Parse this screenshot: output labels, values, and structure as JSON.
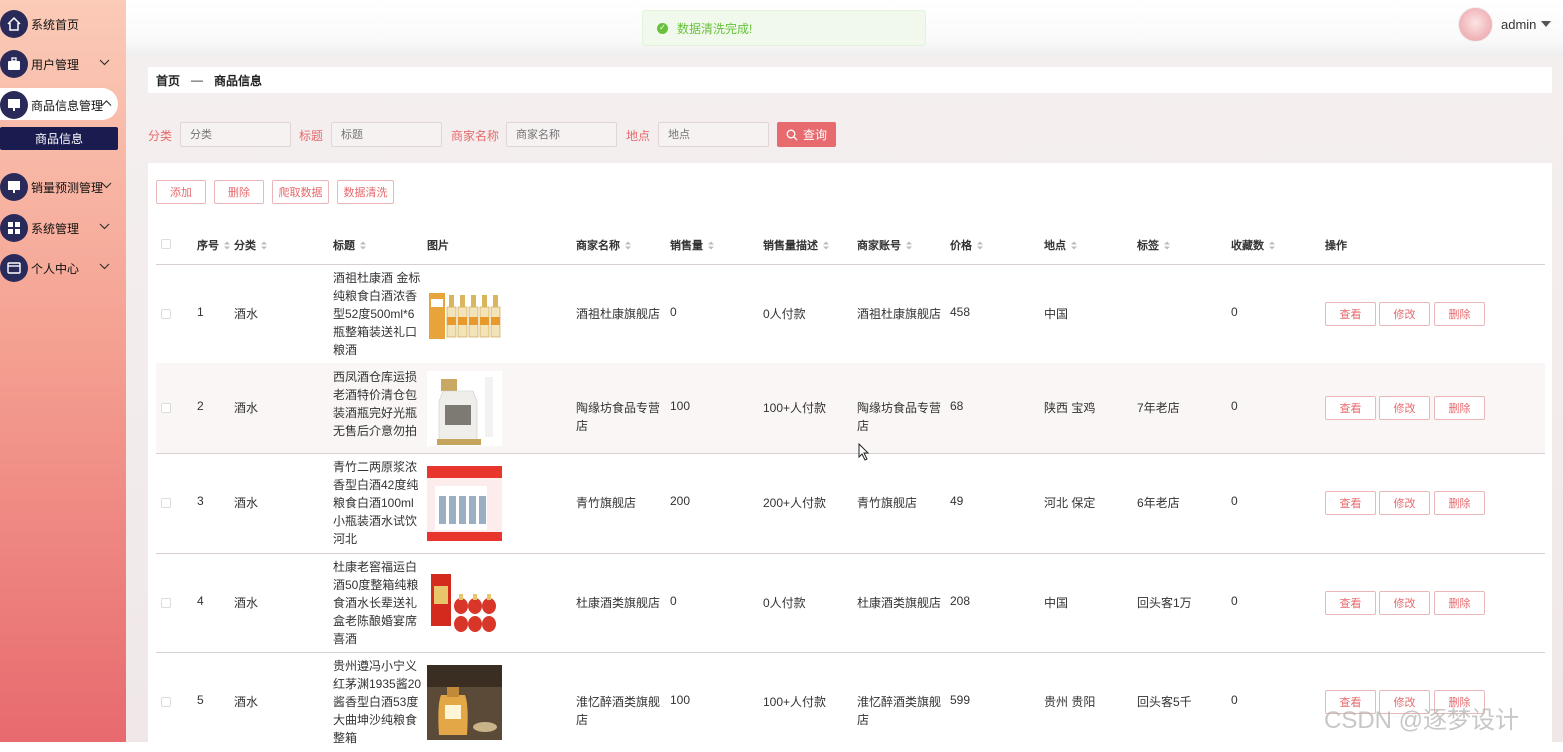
{
  "sidebar": {
    "items": [
      {
        "label": "系统首页",
        "icon": "home-icon"
      },
      {
        "label": "用户管理",
        "icon": "briefcase-icon"
      },
      {
        "label": "商品信息管理",
        "icon": "monitor-icon"
      },
      {
        "label": "销量预测管理",
        "icon": "monitor-icon"
      },
      {
        "label": "系统管理",
        "icon": "grid-icon"
      },
      {
        "label": "个人中心",
        "icon": "wallet-icon"
      }
    ],
    "sub_item": "商品信息"
  },
  "topbar": {
    "toast": "数据清洗完成!",
    "username": "admin"
  },
  "breadcrumb": {
    "home": "首页",
    "separator": "—",
    "current": "商品信息"
  },
  "filters": {
    "fields": [
      {
        "label": "分类",
        "placeholder": "分类"
      },
      {
        "label": "标题",
        "placeholder": "标题"
      },
      {
        "label": "商家名称",
        "placeholder": "商家名称"
      },
      {
        "label": "地点",
        "placeholder": "地点"
      }
    ],
    "search_label": "查询"
  },
  "toolbar": {
    "add": "添加",
    "delete": "删除",
    "crawl": "爬取数据",
    "clean": "数据清洗"
  },
  "table": {
    "columns": [
      "序号",
      "分类",
      "标题",
      "图片",
      "商家名称",
      "销售量",
      "销售量描述",
      "商家账号",
      "价格",
      "地点",
      "标签",
      "收藏数",
      "操作"
    ],
    "actions": {
      "view": "查看",
      "edit": "修改",
      "delete": "删除"
    },
    "rows": [
      {
        "no": "1",
        "category": "酒水",
        "title": "酒祖杜康酒 金标纯粮食白酒浓香型52度500ml*6瓶整箱装送礼口粮酒",
        "shop": "酒祖杜康旗舰店",
        "sales": "0",
        "sales_desc": "0人付款",
        "account": "酒祖杜康旗舰店",
        "price": "458",
        "location": "中国",
        "tag": "",
        "fav": "0"
      },
      {
        "no": "2",
        "category": "酒水",
        "title": "西凤酒仓库运损老酒特价清仓包装酒瓶完好光瓶无售后介意勿拍",
        "shop": "陶缘坊食品专营店",
        "sales": "100",
        "sales_desc": "100+人付款",
        "account": "陶缘坊食品专营店",
        "price": "68",
        "location": "陕西 宝鸡",
        "tag": "7年老店",
        "fav": "0"
      },
      {
        "no": "3",
        "category": "酒水",
        "title": "青竹二两原浆浓香型白酒42度纯粮食白酒100ml小瓶装酒水试饮河北",
        "shop": "青竹旗舰店",
        "sales": "200",
        "sales_desc": "200+人付款",
        "account": "青竹旗舰店",
        "price": "49",
        "location": "河北 保定",
        "tag": "6年老店",
        "fav": "0"
      },
      {
        "no": "4",
        "category": "酒水",
        "title": "杜康老窖福运白酒50度整箱纯粮食酒水长辈送礼盒老陈酿婚宴席喜酒",
        "shop": "杜康酒类旗舰店",
        "sales": "0",
        "sales_desc": "0人付款",
        "account": "杜康酒类旗舰店",
        "price": "208",
        "location": "中国",
        "tag": "回头客1万",
        "fav": "0"
      },
      {
        "no": "5",
        "category": "酒水",
        "title": "贵州遵冯小宁义红茅渊1935酱20酱香型白酒53度大曲坤沙纯粮食整箱",
        "shop": "淮忆醉酒类旗舰店",
        "sales": "100",
        "sales_desc": "100+人付款",
        "account": "淮忆醉酒类旗舰店",
        "price": "599",
        "location": "贵州 贵阳",
        "tag": "回头客5千",
        "fav": "0"
      }
    ]
  },
  "watermark": "CSDN @逐梦设计",
  "colors": {
    "accent": "#e76a6e",
    "navy": "#1a1c4f",
    "success": "#67c23a"
  }
}
